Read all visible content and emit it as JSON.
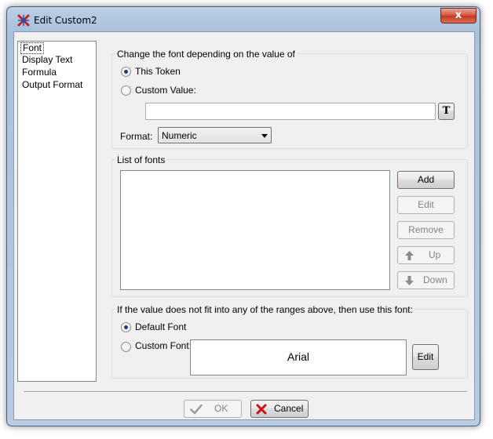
{
  "window": {
    "title": "Edit Custom2",
    "close_glyph": "x"
  },
  "sidebar": {
    "items": [
      {
        "label": "Font",
        "selected": true
      },
      {
        "label": "Display Text",
        "selected": false
      },
      {
        "label": "Formula",
        "selected": false
      },
      {
        "label": "Output Format",
        "selected": false
      }
    ]
  },
  "font_condition": {
    "group_title": "Change the font depending on the value of",
    "this_token_label": "This Token",
    "this_token_checked": true,
    "custom_value_label": "Custom Value:",
    "custom_value_checked": false,
    "custom_value": "",
    "token_button_glyph": "T",
    "format_label": "Format:",
    "format_value": "Numeric"
  },
  "font_list": {
    "group_title": "List of fonts",
    "items": [],
    "add_label": "Add",
    "edit_label": "Edit",
    "remove_label": "Remove",
    "up_label": "Up",
    "down_label": "Down"
  },
  "fallback": {
    "group_title": "If the value does not fit into any of the ranges above, then use this font:",
    "default_font_label": "Default Font",
    "default_font_checked": true,
    "custom_font_label": "Custom Font:",
    "custom_font_checked": false,
    "custom_font_name": "Arial",
    "edit_label": "Edit"
  },
  "footer": {
    "ok_label": "OK",
    "cancel_label": "Cancel"
  },
  "colors": {
    "title_bar": "#a9c1dc",
    "dialog_face": "#f0f0f0",
    "close_button": "#c2381d",
    "cancel_x": "#cc1111"
  },
  "icons": {
    "app": "app-logo-icon",
    "close": "close-icon",
    "token": "text-token-icon",
    "up": "arrow-up-icon",
    "down": "arrow-down-icon",
    "ok": "checkmark-icon",
    "cancel": "cancel-x-icon"
  }
}
